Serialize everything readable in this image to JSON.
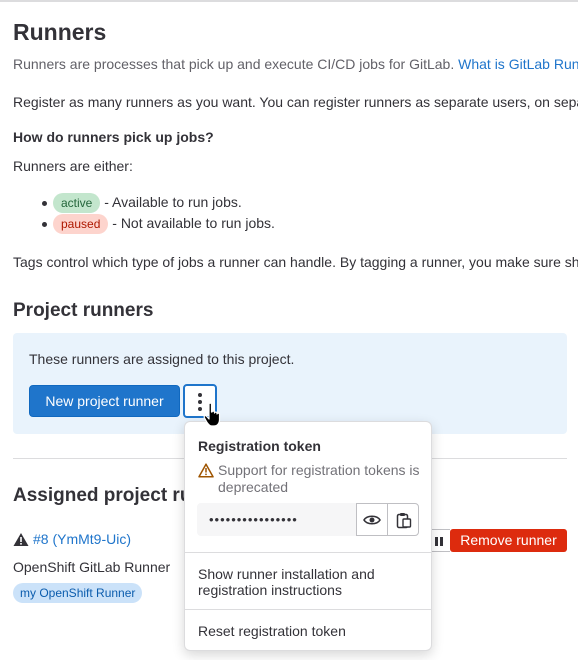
{
  "page": {
    "title": "Runners",
    "intro": "Runners are processes that pick up and execute CI/CD jobs for GitLab.",
    "intro_link": "What is GitLab Runner?",
    "register_text": "Register as many runners as you want. You can register runners as separate users, on separate servers, and on your local machine.",
    "how_heading": "How do runners pick up jobs?",
    "either_text": "Runners are either:",
    "states": [
      {
        "badge": "active",
        "text": "- Available to run jobs."
      },
      {
        "badge": "paused",
        "text": "- Not available to run jobs."
      }
    ],
    "tags_text": "Tags control which type of jobs a runner can handle. By tagging a runner, you make sure shared runners only handle the jobs they are equipped to run."
  },
  "project_runners": {
    "heading": "Project runners",
    "info": "These runners are assigned to this project.",
    "new_button": "New project runner",
    "more_actions_icon": "ellipsis-v-icon"
  },
  "assigned": {
    "heading": "Assigned project runners",
    "runner_id": "#8 (YmMt9-Uic)",
    "runner_name": "OpenShift GitLab Runner",
    "tag": "my OpenShift Runner",
    "remove_button": "Remove runner",
    "pause_icon": "pause-icon",
    "warning_icon": "warning-icon"
  },
  "dropdown": {
    "title": "Registration token",
    "warning": "Support for registration tokens is deprecated",
    "token_masked": "••••••••••••••••",
    "reveal_icon": "eye-icon",
    "copy_icon": "copy-to-clipboard-icon",
    "show_instructions": "Show runner installation and registration instructions",
    "reset_token": "Reset registration token"
  },
  "colors": {
    "primary": "#1f75cb",
    "danger": "#dd2b0e",
    "info_bg": "#e9f3fc",
    "warning": "#9e5400"
  }
}
